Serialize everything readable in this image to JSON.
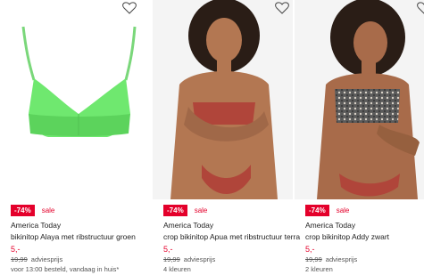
{
  "products": [
    {
      "discount": "-74%",
      "sale_label": "sale",
      "brand": "America Today",
      "title": "bikinitop Alaya met ribstructuur groen",
      "price": "5,-",
      "old_price": "19,99",
      "old_price_label": "adviesprijs",
      "meta": "voor 13:00 besteld, vandaag in huis*",
      "image": "green-bikini-top"
    },
    {
      "discount": "-74%",
      "sale_label": "sale",
      "brand": "America Today",
      "title": "crop bikinitop Apua met ribstructuur terra",
      "price": "5,-",
      "old_price": "19,99",
      "old_price_label": "adviesprijs",
      "meta": "4 kleuren",
      "image": "model-terra-bikini"
    },
    {
      "discount": "-74%",
      "sale_label": "sale",
      "brand": "America Today",
      "title": "crop bikinitop Addy zwart",
      "price": "5,-",
      "old_price": "19,99",
      "old_price_label": "adviesprijs",
      "meta": "2 kleuren",
      "image": "model-printed-bikini"
    }
  ],
  "icons": {
    "wishlist": "heart-outline-icon"
  },
  "colors": {
    "sale_red": "#e4002b",
    "top_green": "#6fe86f",
    "terra": "#b0453a",
    "skin": "#b37752"
  }
}
